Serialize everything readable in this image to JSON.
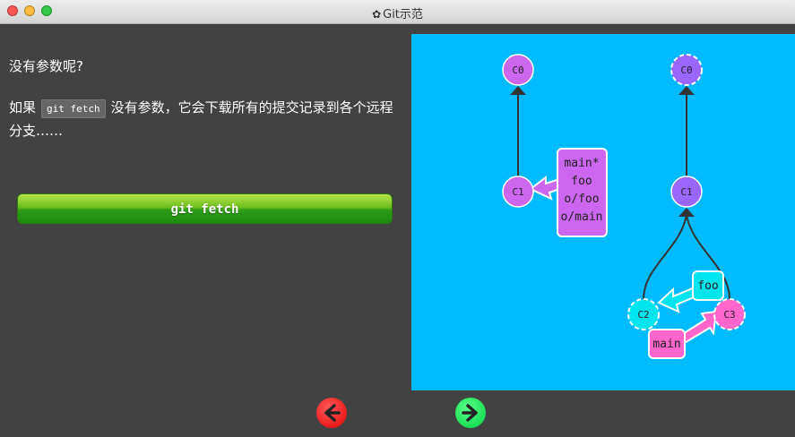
{
  "window": {
    "title": "Git示范"
  },
  "instructions": {
    "line1": "没有参数呢?",
    "line2_prefix": "如果",
    "line2_code": "git fetch",
    "line2_suffix": "没有参数，它会下载所有的提交记录到各个远程分支……"
  },
  "command_button": {
    "label": "git fetch"
  },
  "graph": {
    "left_tree": {
      "commits": [
        {
          "id": "C0",
          "color": "#cc66ee"
        },
        {
          "id": "C1",
          "color": "#cc66ee"
        }
      ],
      "branch_labels": [
        "main*",
        "foo",
        "o/foo",
        "o/main"
      ]
    },
    "right_tree": {
      "commits": [
        {
          "id": "C0",
          "color": "#9966ff",
          "dashed": true
        },
        {
          "id": "C1",
          "color": "#9966ff",
          "dashed": false
        },
        {
          "id": "C2",
          "color": "#00e5ee",
          "dashed": true
        },
        {
          "id": "C3",
          "color": "#ff66cc",
          "dashed": true
        }
      ],
      "branch_labels": [
        {
          "name": "foo",
          "color": "#00e5ee"
        },
        {
          "name": "main",
          "color": "#ff66cc"
        }
      ]
    }
  },
  "navigation": {
    "back_icon": "arrow-left-icon",
    "forward_icon": "arrow-right-icon"
  }
}
